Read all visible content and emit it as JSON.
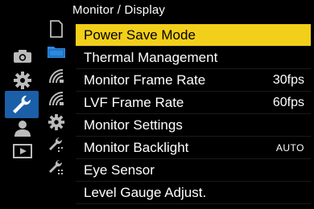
{
  "header": {
    "title": "Monitor / Display"
  },
  "main_tabs": [
    {
      "name": "camera-icon",
      "active": false
    },
    {
      "name": "gear-icon",
      "active": false
    },
    {
      "name": "wrench-icon",
      "active": true
    },
    {
      "name": "person-icon",
      "active": false
    },
    {
      "name": "playback-icon",
      "active": false
    }
  ],
  "sub_tabs": [
    {
      "name": "card-icon"
    },
    {
      "name": "folder-icon"
    },
    {
      "name": "wireless-icon"
    },
    {
      "name": "wireless-icon-2"
    },
    {
      "name": "settings-gear-icon"
    },
    {
      "name": "wrench-page-icon"
    },
    {
      "name": "wrench-page-icon-2"
    }
  ],
  "menu": {
    "items": [
      {
        "label": "Power Save Mode",
        "value": ""
      },
      {
        "label": "Thermal Management",
        "value": ""
      },
      {
        "label": "Monitor Frame Rate",
        "value": "30fps"
      },
      {
        "label": "LVF Frame Rate",
        "value": "60fps"
      },
      {
        "label": "Monitor Settings",
        "value": ""
      },
      {
        "label": "Monitor Backlight",
        "value": "AUTO"
      },
      {
        "label": "Eye Sensor",
        "value": ""
      },
      {
        "label": "Level Gauge Adjust.",
        "value": ""
      }
    ],
    "selected_index": 0
  },
  "colors": {
    "highlight": "#f2cf1a",
    "active_tab": "#1b5fa8",
    "background": "#000000"
  }
}
